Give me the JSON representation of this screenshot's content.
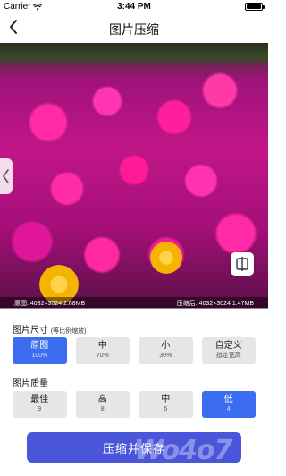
{
  "status_bar": {
    "carrier": "Carrier",
    "time": "3:44 PM"
  },
  "nav": {
    "title": "图片压缩"
  },
  "image_info": {
    "original": "原图: 4032×3024  2.68MB",
    "compressed": "压缩后: 4032×3024  1.47MB"
  },
  "size_section": {
    "label": "图片尺寸",
    "note": "(等比例缩放)",
    "options": [
      {
        "label": "原图",
        "sub": "100%"
      },
      {
        "label": "中",
        "sub": "70%"
      },
      {
        "label": "小",
        "sub": "30%"
      },
      {
        "label": "自定义",
        "sub": "指定宽高"
      }
    ],
    "selected": "原图"
  },
  "quality_section": {
    "label": "图片质量",
    "options": [
      {
        "label": "最佳",
        "sub": "9"
      },
      {
        "label": "高",
        "sub": "8"
      },
      {
        "label": "中",
        "sub": "6"
      },
      {
        "label": "低",
        "sub": "4"
      }
    ],
    "selected": "低"
  },
  "action": {
    "label": "压缩并保存"
  },
  "watermark": "Wo4o7",
  "colors": {
    "accent": "#3c6cf0",
    "button": "#4a55d9",
    "option_bg": "#e6e6e6"
  },
  "icons": [
    "wifi-icon",
    "battery-icon",
    "back-chevron-icon",
    "left-chevron-icon",
    "compare-icon"
  ]
}
